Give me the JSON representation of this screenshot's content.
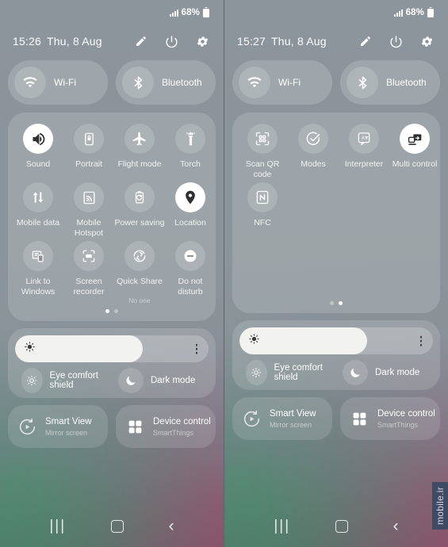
{
  "watermark": "mobile.ir",
  "panels": [
    {
      "id": "left",
      "status": {
        "battery_percent": "68%",
        "signal_icon": "signal-bars-icon",
        "battery_icon": "battery-icon"
      },
      "header": {
        "time": "15:26",
        "date": "Thu, 8 Aug",
        "icons": [
          {
            "name": "edit-pencil-icon",
            "label": "Edit"
          },
          {
            "name": "power-icon",
            "label": "Power"
          },
          {
            "name": "settings-gear-icon",
            "label": "Settings"
          }
        ]
      },
      "connectivity": [
        {
          "label": "Wi-Fi",
          "icon": "wifi-icon",
          "active": false
        },
        {
          "label": "Bluetooth",
          "icon": "bluetooth-icon",
          "active": false
        }
      ],
      "tiles": [
        {
          "label": "Sound",
          "sub": "",
          "icon": "sound-icon",
          "active": true
        },
        {
          "label": "Portrait",
          "sub": "",
          "icon": "rotation-lock-icon",
          "active": false
        },
        {
          "label": "Flight mode",
          "sub": "",
          "icon": "airplane-icon",
          "active": false
        },
        {
          "label": "Torch",
          "sub": "",
          "icon": "flashlight-icon",
          "active": false
        },
        {
          "label": "Mobile data",
          "sub": "",
          "icon": "mobile-data-icon",
          "active": false
        },
        {
          "label": "Mobile Hotspot",
          "sub": "",
          "icon": "hotspot-icon",
          "active": false
        },
        {
          "label": "Power saving",
          "sub": "",
          "icon": "battery-saver-icon",
          "active": false
        },
        {
          "label": "Location",
          "sub": "",
          "icon": "location-pin-icon",
          "active": true
        },
        {
          "label": "Link to Windows",
          "sub": "",
          "icon": "link-to-windows-icon",
          "active": false
        },
        {
          "label": "Screen recorder",
          "sub": "",
          "icon": "screen-recorder-icon",
          "active": false
        },
        {
          "label": "Quick Share",
          "sub": "No one",
          "icon": "quick-share-icon",
          "active": false
        },
        {
          "label": "Do not disturb",
          "sub": "",
          "icon": "do-not-disturb-icon",
          "active": false
        }
      ],
      "page_count": 2,
      "page_active": 0,
      "brightness": {
        "percent": 66,
        "icon": "brightness-sun-icon",
        "menu_icon": "more-options-icon"
      },
      "brightness_row": [
        {
          "label": "Eye comfort shield",
          "icon": "eye-comfort-icon"
        },
        {
          "label": "Dark mode",
          "icon": "moon-icon"
        }
      ],
      "bottom_tiles": [
        {
          "title": "Smart View",
          "subtitle": "Mirror screen",
          "icon": "smart-view-icon"
        },
        {
          "title": "Device control",
          "subtitle": "SmartThings",
          "icon": "device-control-icon"
        }
      ],
      "nav": [
        {
          "name": "recents-button",
          "glyph": "|||"
        },
        {
          "name": "home-button",
          "glyph": ""
        },
        {
          "name": "back-button",
          "glyph": "‹"
        }
      ]
    },
    {
      "id": "right",
      "status": {
        "battery_percent": "68%",
        "signal_icon": "signal-bars-icon",
        "battery_icon": "battery-icon"
      },
      "header": {
        "time": "15:27",
        "date": "Thu, 8 Aug",
        "icons": [
          {
            "name": "edit-pencil-icon",
            "label": "Edit"
          },
          {
            "name": "power-icon",
            "label": "Power"
          },
          {
            "name": "settings-gear-icon",
            "label": "Settings"
          }
        ]
      },
      "connectivity": [
        {
          "label": "Wi-Fi",
          "icon": "wifi-icon",
          "active": false
        },
        {
          "label": "Bluetooth",
          "icon": "bluetooth-icon",
          "active": false
        }
      ],
      "tiles": [
        {
          "label": "Scan QR code",
          "sub": "",
          "icon": "scan-qr-icon",
          "active": false
        },
        {
          "label": "Modes",
          "sub": "",
          "icon": "modes-check-icon",
          "active": false
        },
        {
          "label": "Interpreter",
          "sub": "",
          "icon": "interpreter-icon",
          "active": false
        },
        {
          "label": "Multi control",
          "sub": "",
          "icon": "multi-control-icon",
          "active": true
        },
        {
          "label": "NFC",
          "sub": "",
          "icon": "nfc-icon",
          "active": false
        }
      ],
      "page_count": 2,
      "page_active": 1,
      "brightness": {
        "percent": 66,
        "icon": "brightness-sun-icon",
        "menu_icon": "more-options-icon"
      },
      "brightness_row": [
        {
          "label": "Eye comfort shield",
          "icon": "eye-comfort-icon"
        },
        {
          "label": "Dark mode",
          "icon": "moon-icon"
        }
      ],
      "bottom_tiles": [
        {
          "title": "Smart View",
          "subtitle": "Mirror screen",
          "icon": "smart-view-icon"
        },
        {
          "title": "Device control",
          "subtitle": "SmartThings",
          "icon": "device-control-icon"
        }
      ],
      "nav": [
        {
          "name": "recents-button",
          "glyph": "|||"
        },
        {
          "name": "home-button",
          "glyph": ""
        },
        {
          "name": "back-button",
          "glyph": "‹"
        }
      ]
    }
  ]
}
